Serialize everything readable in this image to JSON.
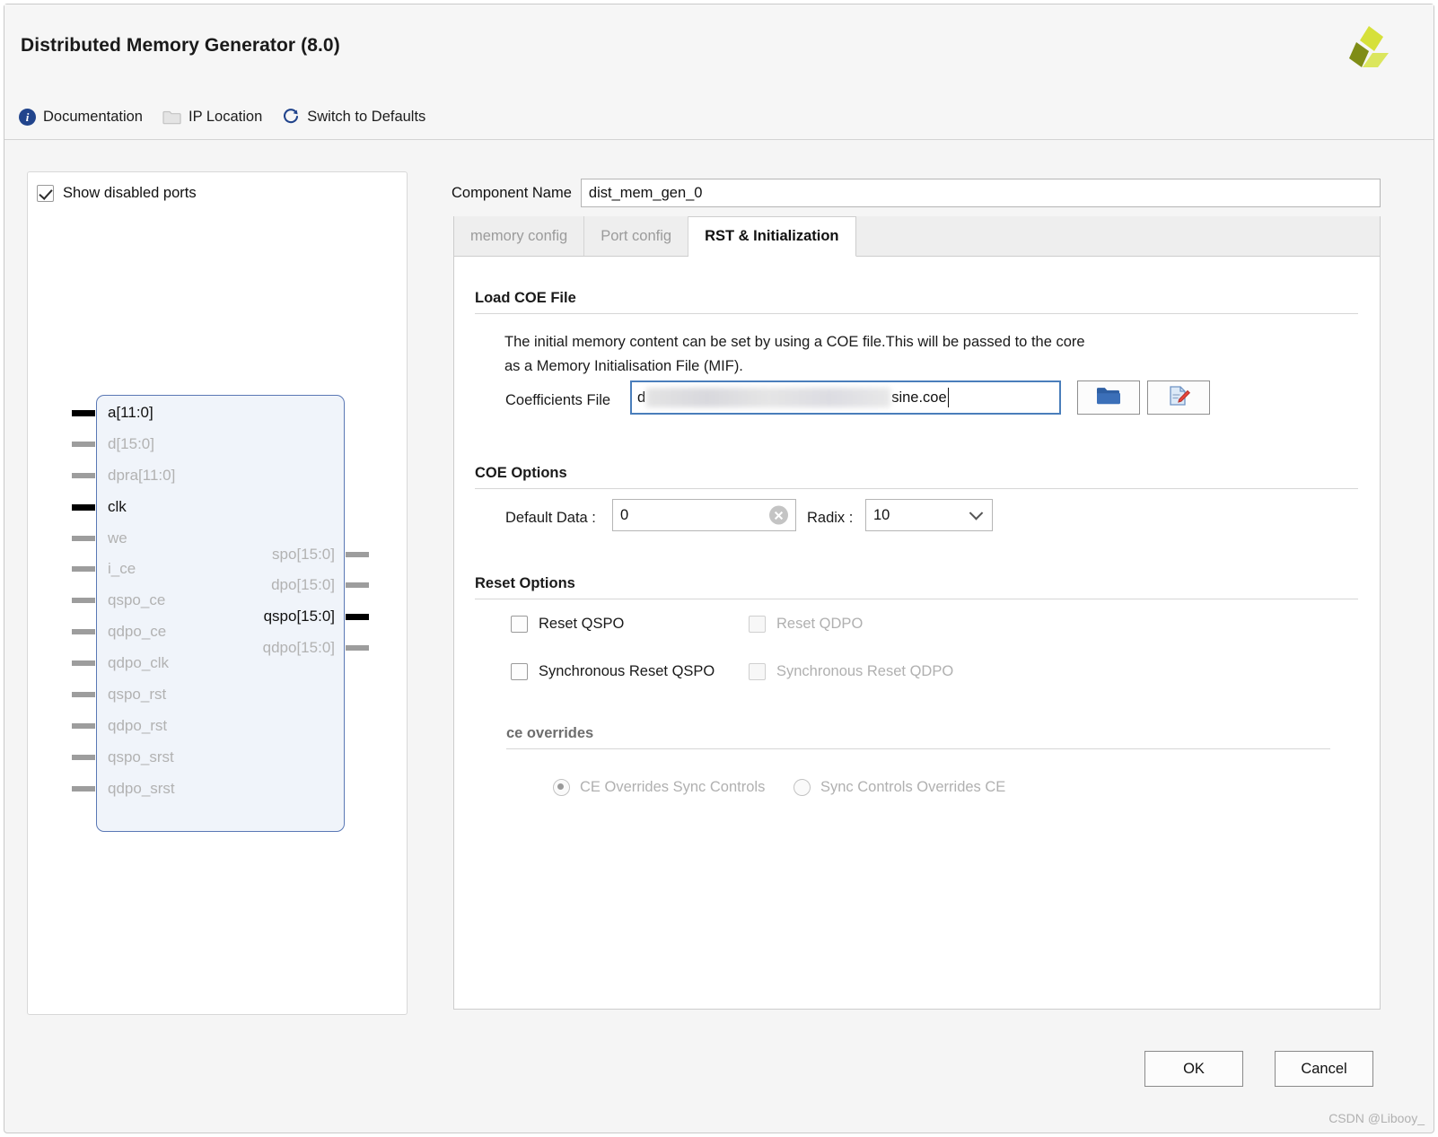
{
  "window": {
    "title": "Distributed Memory Generator (8.0)",
    "logo_icon": "xilinx-logo",
    "logo_colors": {
      "light": "#d6e03a",
      "mid": "#c9d62a",
      "dark": "#7f8c16"
    }
  },
  "toolbar": {
    "items": [
      {
        "label": "Documentation",
        "icon": "info-icon"
      },
      {
        "label": "IP Location",
        "icon": "folder-icon"
      },
      {
        "label": "Switch to Defaults",
        "icon": "refresh-icon"
      }
    ]
  },
  "left_panel": {
    "show_disabled_ports": {
      "label": "Show disabled ports",
      "checked": true
    },
    "symbol": {
      "inputs": [
        {
          "label": "a[11:0]",
          "enabled": true
        },
        {
          "label": "d[15:0]",
          "enabled": false
        },
        {
          "label": "dpra[11:0]",
          "enabled": false
        },
        {
          "label": "clk",
          "enabled": true
        },
        {
          "label": "we",
          "enabled": false
        },
        {
          "label": "i_ce",
          "enabled": false
        },
        {
          "label": "qspo_ce",
          "enabled": false
        },
        {
          "label": "qdpo_ce",
          "enabled": false
        },
        {
          "label": "qdpo_clk",
          "enabled": false
        },
        {
          "label": "qspo_rst",
          "enabled": false
        },
        {
          "label": "qdpo_rst",
          "enabled": false
        },
        {
          "label": "qspo_srst",
          "enabled": false
        },
        {
          "label": "qdpo_srst",
          "enabled": false
        }
      ],
      "outputs": [
        {
          "label": "spo[15:0]",
          "enabled": false
        },
        {
          "label": "dpo[15:0]",
          "enabled": false
        },
        {
          "label": "qspo[15:0]",
          "enabled": true
        },
        {
          "label": "qdpo[15:0]",
          "enabled": false
        }
      ]
    }
  },
  "main": {
    "component_name": {
      "label": "Component Name",
      "value": "dist_mem_gen_0"
    },
    "tabs": [
      {
        "label": "memory config",
        "active": false
      },
      {
        "label": "Port config",
        "active": false
      },
      {
        "label": "RST & Initialization",
        "active": true
      }
    ],
    "load_coe": {
      "title": "Load COE File",
      "description_line1": "The initial memory content can be set by using a COE file.This will be passed to the core",
      "description_line2": "as a Memory Initialisation File (MIF).",
      "coefficients_label": "Coefficients File",
      "value_prefix": "d",
      "value_suffix": "sine.coe",
      "browse_icon": "folder-open-icon",
      "edit_icon": "document-edit-icon"
    },
    "coe_options": {
      "title": "COE Options",
      "default_data_label": "Default Data :",
      "default_data_value": "0",
      "clear_icon": "clear-circle-icon",
      "radix_label": "Radix :",
      "radix_value": "10",
      "dropdown_icon": "chevron-down-icon"
    },
    "reset_options": {
      "title": "Reset Options",
      "checkboxes": [
        {
          "label": "Reset QSPO",
          "checked": false,
          "enabled": true
        },
        {
          "label": "Reset QDPO",
          "checked": false,
          "enabled": false
        },
        {
          "label": "Synchronous Reset QSPO",
          "checked": false,
          "enabled": true
        },
        {
          "label": "Synchronous Reset QDPO",
          "checked": false,
          "enabled": false
        }
      ],
      "ce_overrides": {
        "title": "ce overrides",
        "options": [
          {
            "label": "CE Overrides Sync Controls",
            "selected": true
          },
          {
            "label": "Sync Controls Overrides CE",
            "selected": false
          }
        ]
      }
    }
  },
  "footer": {
    "ok_label": "OK",
    "cancel_label": "Cancel",
    "watermark": "CSDN @Libooy_"
  }
}
